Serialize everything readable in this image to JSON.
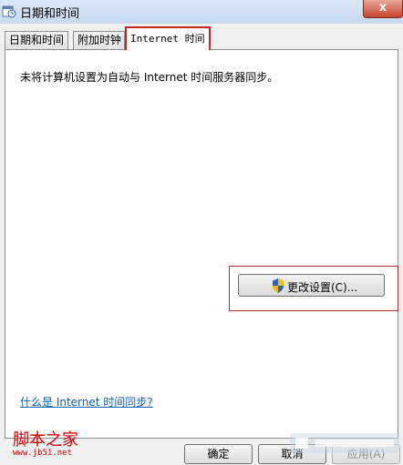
{
  "window": {
    "title": "日期和时间",
    "close_label": "x"
  },
  "tabs": [
    {
      "label": "日期和时间",
      "active": false
    },
    {
      "label": "附加时钟",
      "active": false
    },
    {
      "label": "Internet 时间",
      "active": true
    }
  ],
  "panel": {
    "status": "未将计算机设置为自动与 Internet 时间服务器同步。",
    "change_button": "更改设置(C)...",
    "help_link": "什么是 Internet 时间同步?"
  },
  "footer": {
    "ok": "确定",
    "cancel": "取消",
    "apply": "应用(A)"
  },
  "watermark": {
    "site_name": "脚本之家",
    "site_url": "www.jb51.net"
  },
  "colors": {
    "highlight_red": "#c0272d",
    "link_blue": "#0b5fb0"
  }
}
